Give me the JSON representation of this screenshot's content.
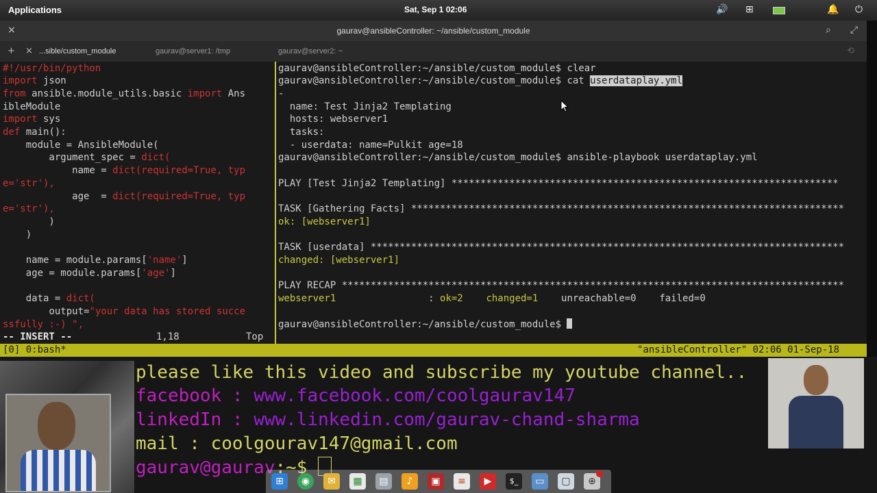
{
  "top_panel": {
    "apps_label": "Applications",
    "clock": "Sat, Sep 1   02:06",
    "tray_icons": [
      "volume-icon",
      "network-icon",
      "battery-icon",
      "notification-icon",
      "power-icon"
    ]
  },
  "window": {
    "title": "gaurav@ansibleController: ~/ansible/custom_module",
    "close_glyph": "×",
    "search_glyph": "⌕",
    "fullscreen_glyph": "⤢"
  },
  "tabs": {
    "new_tab_glyph": "+",
    "close_tab_glyph": "×",
    "items": [
      {
        "label": "...sible/custom_module"
      },
      {
        "label": "gaurav@server1: /tmp"
      },
      {
        "label": "gaurav@server2: ~"
      }
    ],
    "restore_glyph": "⟲"
  },
  "vim": {
    "lines": [
      "#!/usr/bin/python",
      "import",
      " json",
      "from",
      " ansible.module_utils.basic ",
      "import",
      " Ans",
      "ibleModule",
      "import",
      " sys",
      "def",
      " main():",
      "    module = AnsibleModule(",
      "        argument_spec = ",
      "dict(",
      "            name = ",
      "dict(required=True, typ",
      "e='str'),",
      "            age  = ",
      "dict(required=True, typ",
      "e='str'),",
      "        )",
      "    )",
      "    name = module.params[",
      "'name'",
      "]",
      "    age = module.params[",
      "'age'",
      "]",
      "    data = ",
      "dict(",
      "        output=",
      "\"your data has stored succe",
      "ssfully :-) \",",
      "-- INSERT --",
      "1,18",
      "Top"
    ]
  },
  "terminal": {
    "prompt": "gaurav@ansibleController:~/ansible/custom_module$",
    "cmd_clear": " clear",
    "cmd_cat": " cat ",
    "cat_file": "userdataplay.yml",
    "yaml": [
      "-",
      "  name: Test Jinja2 Templating",
      "  hosts: webserver1",
      "  tasks:",
      "  - userdata: name=Pulkit age=18"
    ],
    "cmd_playbook": " ansible-playbook userdataplay.yml",
    "play": "PLAY [Test Jinja2 Templating] *******************************************************************",
    "task_facts": "TASK [Gathering Facts] ***************************************************************************",
    "ok_line": "ok: [webserver1]",
    "task_userdata": "TASK [userdata] **********************************************************************************",
    "changed_line": "changed: [webserver1]",
    "recap": "PLAY RECAP ***************************************************************************************",
    "recap_host": "webserver1",
    "recap_sep": "                : ",
    "recap_ok": "ok=2",
    "recap_changed": "    changed=1",
    "recap_rest": "    unreachable=0    failed=0"
  },
  "tmux": {
    "left": "[0] 0:bash*",
    "right": "\"ansibleController\" 02:06 01-Sep-18"
  },
  "overlay": {
    "like_line": "please like this video and subscribe my youtube channel..",
    "fb_label": "facebook : ",
    "fb_url": "www.facebook.com/coolgaurav147",
    "li_label": "linkedIn : ",
    "li_url": "www.linkedin.com/gaurav-chand-sharma",
    "mail_label": "mail : ",
    "mail_value": "coolgourav147@gmail.com",
    "shell_prompt": "gaurav@gaurav",
    "shell_tail": ":~$ "
  },
  "dock": {
    "icons": [
      "windows-icon",
      "browser-icon",
      "mail-icon",
      "spreadsheet-icon",
      "files-icon",
      "music-icon",
      "presentation-icon",
      "document-icon",
      "video-icon",
      "terminal-icon",
      "folder-icon",
      "monitor-icon",
      "software-center-icon"
    ]
  },
  "colors": {
    "terminal_bg": "#1a1a1a",
    "keyword_red": "#cc3333",
    "tmux_yellow": "#b8b81a",
    "overlay_yellow": "#d4d466",
    "overlay_pink": "#c01fc0"
  }
}
